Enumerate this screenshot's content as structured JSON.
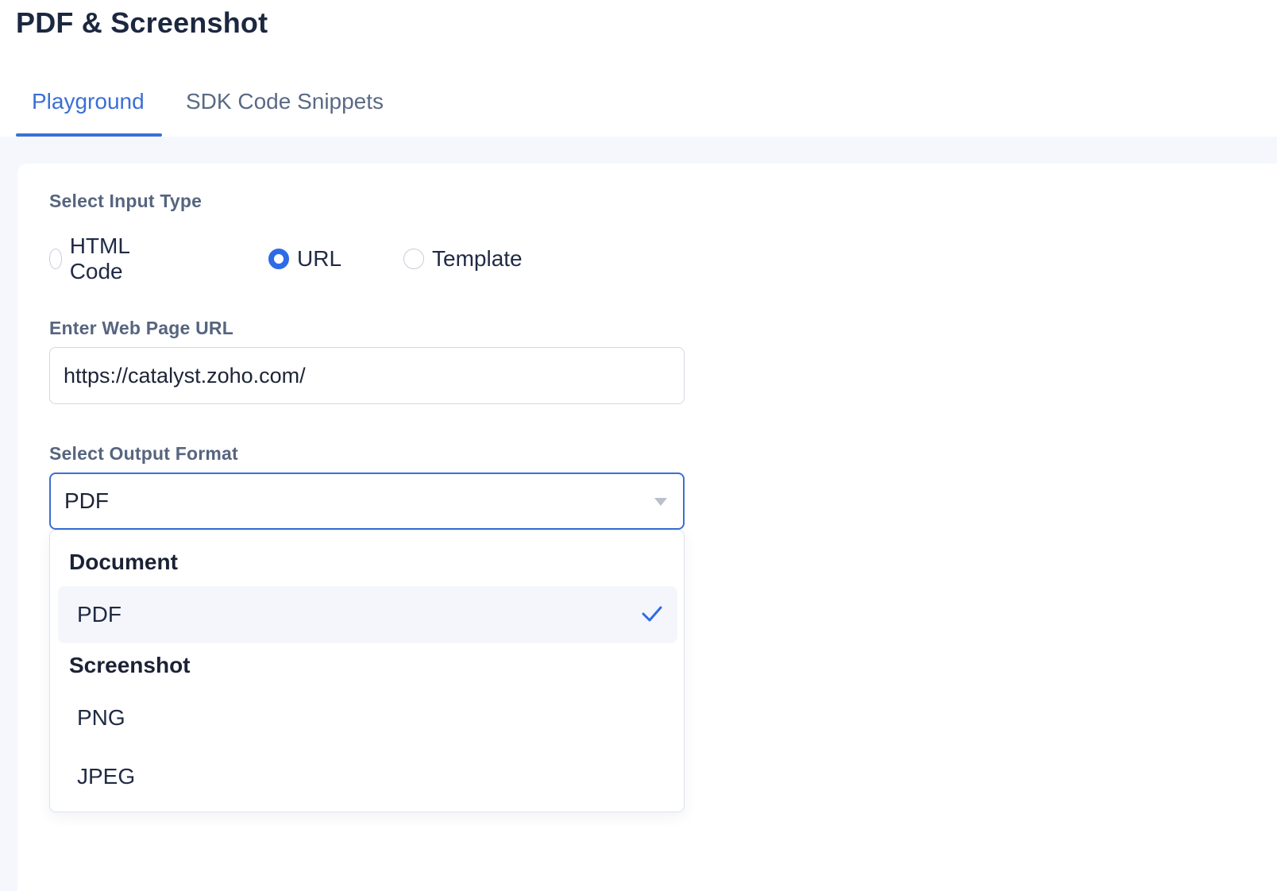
{
  "page": {
    "title": "PDF & Screenshot"
  },
  "tabs": [
    {
      "label": "Playground",
      "active": true
    },
    {
      "label": "SDK Code Snippets",
      "active": false
    }
  ],
  "form": {
    "input_type_label": "Select Input Type",
    "input_type_options": [
      {
        "label": "HTML Code",
        "checked": false
      },
      {
        "label": "URL",
        "checked": true
      },
      {
        "label": "Template",
        "checked": false
      }
    ],
    "url_label": "Enter Web Page URL",
    "url_value": "https://catalyst.zoho.com/",
    "output_format_label": "Select Output Format",
    "output_format_selected": "PDF"
  },
  "dropdown": {
    "groups": [
      {
        "title": "Document",
        "options": [
          {
            "label": "PDF",
            "selected": true
          }
        ]
      },
      {
        "title": "Screenshot",
        "options": [
          {
            "label": "PNG",
            "selected": false
          },
          {
            "label": "JPEG",
            "selected": false
          }
        ]
      }
    ]
  },
  "colors": {
    "accent": "#3b6fd4",
    "radio_checked": "#2e6be6",
    "label": "#56657f",
    "panel_bg": "#f5f7fc"
  },
  "icons": {
    "check": "check-icon",
    "caret": "chevron-down-icon"
  }
}
